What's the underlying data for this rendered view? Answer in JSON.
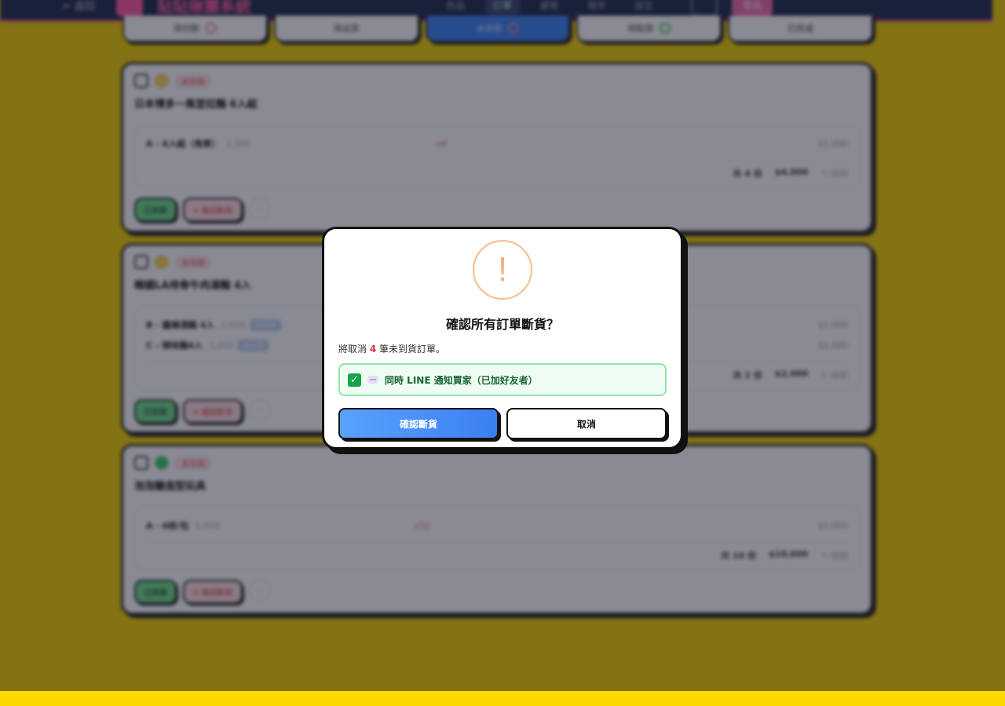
{
  "topbar": {
    "back_label": "← 返回",
    "brand": "貼貼揪團系統",
    "nav": [
      "商品",
      "訂單",
      "顧客",
      "報表",
      "設定"
    ],
    "logout_label": "登出"
  },
  "tabs": [
    {
      "label": "待付款"
    },
    {
      "label": "待出貨"
    },
    {
      "label": "未到貨",
      "active": true
    },
    {
      "label": "待取貨"
    },
    {
      "label": "已完成"
    }
  ],
  "orders": [
    {
      "tag": "未到貨",
      "title": "日本博多一風堂拉麵 6入組",
      "items": [
        {
          "name": "A - 6入組（角煮）",
          "spec": "1,000",
          "badge": "",
          "qty": "x4",
          "price": "$1,000"
        }
      ],
      "total_label": "共 4 份",
      "total_value": "$4,000",
      "edit_label": "✎ 編輯"
    },
    {
      "tag": "未到貨",
      "title": "韓國LA排骨牛肉湯麵 4入",
      "items": [
        {
          "name": "B - 醬燒湯麵 4入",
          "spec": "1,000",
          "badge": "未到貨",
          "qty": "",
          "price": "$1,000"
        },
        {
          "name": "C - 辣味麵4入",
          "spec": "1,000",
          "badge": "未到貨",
          "qty": "",
          "price": "$1,000"
        }
      ],
      "total_label": "共 2 份",
      "total_value": "$2,000",
      "edit_label": "✎ 編輯"
    },
    {
      "tag": "未到貨",
      "title": "泡泡糖造型玩具",
      "items": [
        {
          "name": "A - 6枝/包",
          "spec": "1,000",
          "badge": "",
          "qty": "x10",
          "price": "$1,000"
        }
      ],
      "total_label": "共 10 份",
      "total_value": "$10,000",
      "edit_label": "✎ 編輯"
    }
  ],
  "order_actions": {
    "arrived": "已到貨",
    "cancel": "✕ 確認斷貨",
    "more": "⋯"
  },
  "dialog": {
    "warning_symbol": "!",
    "title": "確認所有訂單斷貨？",
    "desc_prefix": "將取消 ",
    "desc_count": "4",
    "desc_suffix": " 筆未到貨訂單。",
    "notify_checked": true,
    "notify_label": "同時 LINE 通知買家（已加好友者）",
    "confirm_label": "確認斷貨",
    "cancel_label": "取消"
  },
  "colors": {
    "accent": "#3b82f6",
    "brand": "#ff5aa0",
    "success": "#16a34a",
    "danger": "#e02b3a",
    "warning": "#f6b27c"
  },
  "icons": {
    "warning": "exclamation-circle-icon",
    "check": "checkbox-checked-icon",
    "line": "line-app-icon"
  }
}
